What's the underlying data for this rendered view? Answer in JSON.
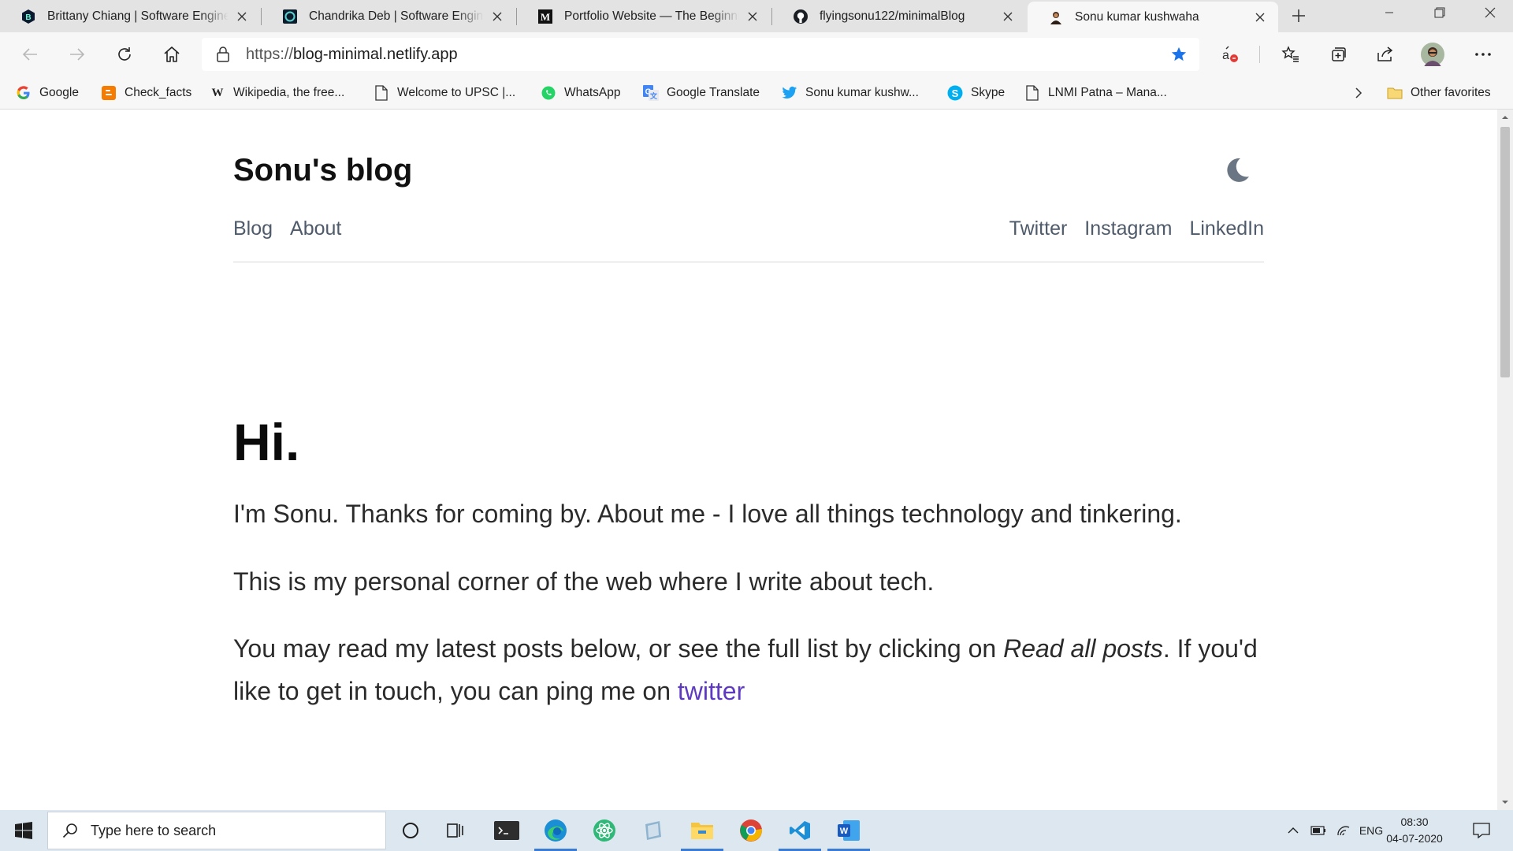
{
  "browser": {
    "tabs": [
      {
        "title": "Brittany Chiang | Software Engineer",
        "icon": "brittany-favicon"
      },
      {
        "title": "Chandrika Deb | Software Engineer",
        "icon": "chandrika-favicon"
      },
      {
        "title": "Portfolio Website — The Beginning",
        "icon": "medium-favicon"
      },
      {
        "title": "flyingsonu122/minimalBlog",
        "icon": "github-favicon"
      },
      {
        "title": "Sonu kumar kushwaha",
        "icon": "sonu-favicon"
      }
    ],
    "url_protocol": "https://",
    "url_host": "blog-minimal.netlify.app",
    "favorites": [
      {
        "label": "Google",
        "icon": "google-icon"
      },
      {
        "label": "Check_facts",
        "icon": "blogger-icon"
      },
      {
        "label": "Wikipedia, the free...",
        "icon": "wikipedia-icon"
      },
      {
        "label": "Welcome to UPSC |...",
        "icon": "page-icon"
      },
      {
        "label": "WhatsApp",
        "icon": "whatsapp-icon"
      },
      {
        "label": "Google Translate",
        "icon": "google-translate-icon"
      },
      {
        "label": "Sonu kumar kushw...",
        "icon": "twitter-icon"
      },
      {
        "label": "Skype",
        "icon": "skype-icon"
      },
      {
        "label": "LNMI Patna – Mana...",
        "icon": "page-icon"
      }
    ],
    "other_favorites": "Other favorites"
  },
  "site": {
    "title": "Sonu's blog",
    "nav_left": [
      "Blog",
      "About"
    ],
    "nav_right": [
      "Twitter",
      "Instagram",
      "LinkedIn"
    ]
  },
  "hero": {
    "heading": "Hi.",
    "para1": "I'm Sonu. Thanks for coming by. About me - I love all things technology and tinkering.",
    "para2": "This is my personal corner of the web where I write about tech.",
    "para3_before": "You may read my latest posts below, or see the full list by clicking on ",
    "para3_em": "Read all posts",
    "para3_mid": ". If you'd like to get in touch, you can ping me on ",
    "para3_link": "twitter"
  },
  "taskbar": {
    "search_placeholder": "Type here to search",
    "language": "ENG",
    "time": "08:30",
    "date": "04-07-2020"
  },
  "colors": {
    "link": "#5e39c2",
    "nav_text": "#4f5b6a",
    "star": "#1a73e8",
    "taskbar": "#dde7f0"
  }
}
